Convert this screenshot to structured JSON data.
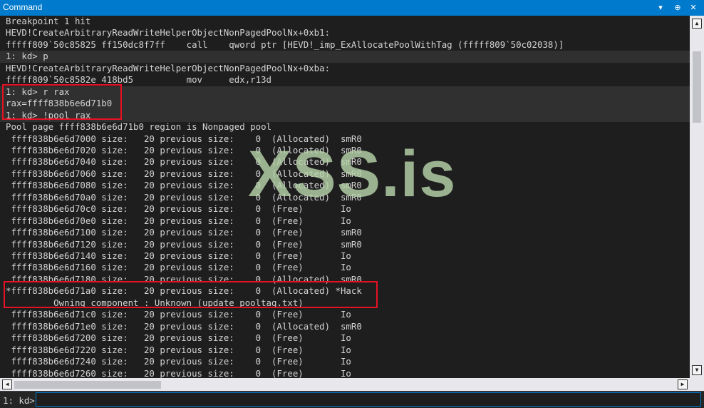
{
  "window": {
    "title": "Command",
    "dropdown_glyph": "▾",
    "pin_glyph": "⊕",
    "close_glyph": "✕"
  },
  "output_lines": [
    "Breakpoint 1 hit",
    "HEVD!CreateArbitraryReadWriteHelperObjectNonPagedPoolNx+0xb1:",
    "fffff809`50c85825 ff150dc8f7ff    call    qword ptr [HEVD!_imp_ExAllocatePoolWithTag (fffff809`50c02038)]",
    "1: kd> p",
    "HEVD!CreateArbitraryReadWriteHelperObjectNonPagedPoolNx+0xba:",
    "fffff809`50c8582e 418bd5          mov     edx,r13d",
    "1: kd> r rax",
    "rax=ffff838b6e6d71b0",
    "1: kd> !pool rax",
    "Pool page ffff838b6e6d71b0 region is Nonpaged pool",
    " ffff838b6e6d7000 size:   20 previous size:    0  (Allocated)  smR0",
    " ffff838b6e6d7020 size:   20 previous size:    0  (Allocated)  smR0",
    " ffff838b6e6d7040 size:   20 previous size:    0  (Allocated)  smR0",
    " ffff838b6e6d7060 size:   20 previous size:    0  (Allocated)  smR0",
    " ffff838b6e6d7080 size:   20 previous size:    0  (Allocated)  smR0",
    " ffff838b6e6d70a0 size:   20 previous size:    0  (Allocated)  smR0",
    " ffff838b6e6d70c0 size:   20 previous size:    0  (Free)       Io",
    " ffff838b6e6d70e0 size:   20 previous size:    0  (Free)       Io",
    " ffff838b6e6d7100 size:   20 previous size:    0  (Free)       smR0",
    " ffff838b6e6d7120 size:   20 previous size:    0  (Free)       smR0",
    " ffff838b6e6d7140 size:   20 previous size:    0  (Free)       Io",
    " ffff838b6e6d7160 size:   20 previous size:    0  (Free)       Io",
    " ffff838b6e6d7180 size:   20 previous size:    0  (Allocated)  smR0",
    "*ffff838b6e6d71a0 size:   20 previous size:    0  (Allocated) *Hack",
    "         Owning component : Unknown (update pooltag.txt)",
    " ffff838b6e6d71c0 size:   20 previous size:    0  (Free)       Io",
    " ffff838b6e6d71e0 size:   20 previous size:    0  (Allocated)  smR0",
    " ffff838b6e6d7200 size:   20 previous size:    0  (Free)       Io",
    " ffff838b6e6d7220 size:   20 previous size:    0  (Free)       Io",
    " ffff838b6e6d7240 size:   20 previous size:    0  (Free)       Io",
    " ffff838b6e6d7260 size:   20 previous size:    0  (Free)       Io"
  ],
  "command_line_indices": [
    3,
    6,
    7,
    8
  ],
  "watermark": "XSS.is",
  "scrollbar": {
    "up_glyph": "▲",
    "down_glyph": "▼",
    "left_glyph": "◀",
    "right_glyph": "▶"
  },
  "command_bar": {
    "prompt": "1: kd>",
    "value": ""
  },
  "colors": {
    "accent": "#007acc",
    "highlight_box": "#e81123",
    "console_bg": "#1e1e1e",
    "text": "#d4d4d4"
  }
}
